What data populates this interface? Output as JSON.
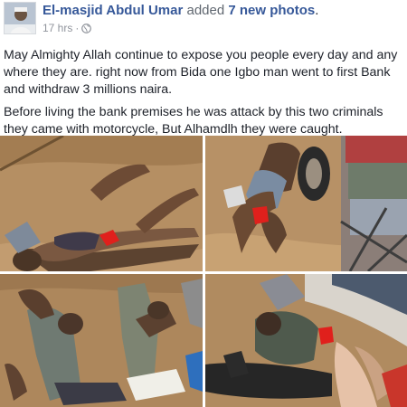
{
  "post": {
    "author": "El-masjid Abdul Umar",
    "action": "added",
    "photo_count": "7 new photos",
    "period": ".",
    "timestamp": "17 hrs",
    "separator": "·",
    "privacy_icon": "globe-icon",
    "message_paragraphs": [
      "May Almighty Allah continue to expose you people every day and any where they are. right now from Bida one Igbo man went to first Bank and withdraw 3 millions naira.",
      "Before living the bank premises he was attack by this two criminals they came with motorcycle, But Alhamdlh they were caught."
    ]
  },
  "photos": [
    {
      "id": "photo-1"
    },
    {
      "id": "photo-2"
    },
    {
      "id": "photo-3"
    },
    {
      "id": "photo-4"
    }
  ],
  "colors": {
    "link": "#365899",
    "text": "#1d2129",
    "meta": "#90949c",
    "ground": "#b08a5e",
    "blood": "#e0201c"
  }
}
